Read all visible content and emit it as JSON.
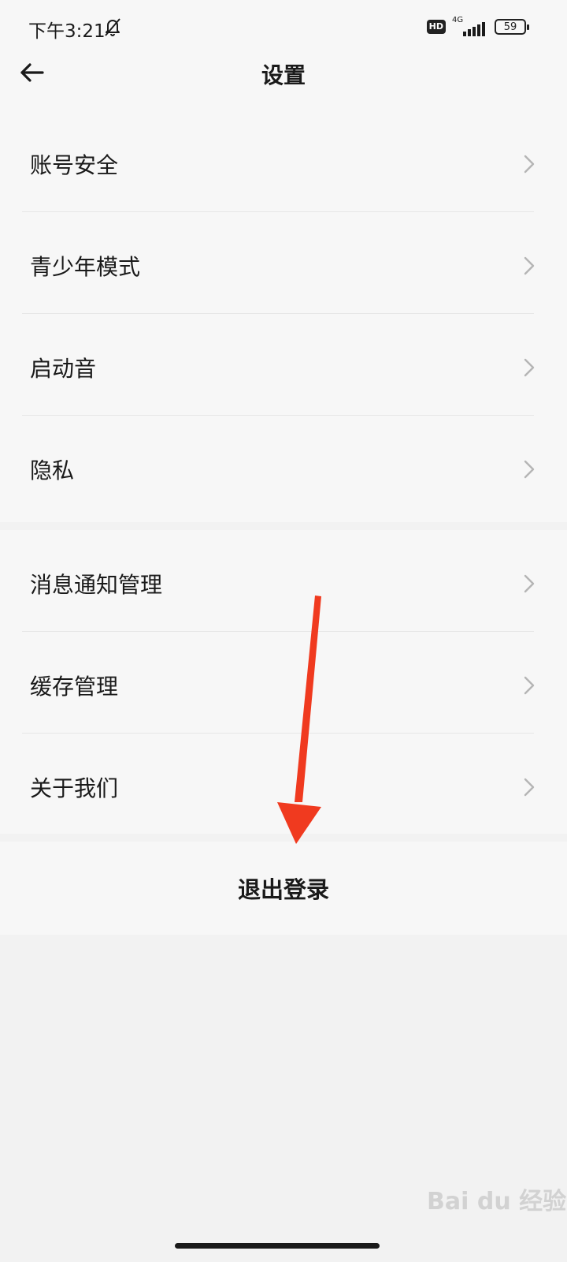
{
  "status_bar": {
    "time": "下午3:21",
    "hd": "HD",
    "network": "4G",
    "battery": "59",
    "icons": [
      "bell-off-icon",
      "signal-icon",
      "battery-icon"
    ]
  },
  "header": {
    "title": "设置",
    "back_icon": "arrow-left-icon"
  },
  "settings": {
    "group1": [
      {
        "label": "账号安全"
      },
      {
        "label": "青少年模式"
      },
      {
        "label": "启动音"
      },
      {
        "label": "隐私"
      }
    ],
    "group2": [
      {
        "label": "消息通知管理"
      },
      {
        "label": "缓存管理"
      },
      {
        "label": "关于我们"
      }
    ]
  },
  "logout": {
    "label": "退出登录"
  },
  "annotation": {
    "arrow_color": "#f03a1f"
  },
  "watermark": {
    "text": "Bai du 经验"
  },
  "colors": {
    "background": "#f2f2f2",
    "card": "#f7f7f7",
    "chevron": "#b5b5b5"
  }
}
